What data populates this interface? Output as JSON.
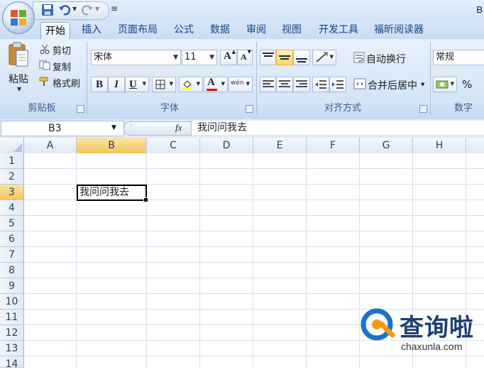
{
  "title_partial": "B",
  "tabs": [
    "开始",
    "插入",
    "页面布局",
    "公式",
    "数据",
    "审阅",
    "视图",
    "开发工具",
    "福昕阅读器"
  ],
  "clipboard": {
    "paste": "粘贴",
    "cut": "剪切",
    "copy": "复制",
    "format_painter": "格式刷",
    "label": "剪贴板"
  },
  "font": {
    "name": "宋体",
    "size": "11",
    "bold": "B",
    "italic": "I",
    "underline": "U",
    "label": "字体",
    "grow": "A",
    "shrink": "A",
    "phonetic": "wén"
  },
  "alignment": {
    "wrap": "自动换行",
    "merge": "合并后居中",
    "label": "对齐方式"
  },
  "number": {
    "format": "常规",
    "percent": "%",
    "label": "数字"
  },
  "formula_bar": {
    "name_box": "B3",
    "fx": "fx",
    "content": "我问问我去"
  },
  "columns": [
    "A",
    "B",
    "C",
    "D",
    "E",
    "F",
    "G",
    "H"
  ],
  "rows": [
    "1",
    "2",
    "3",
    "4",
    "5",
    "6",
    "7",
    "8",
    "9",
    "10",
    "11",
    "12",
    "13",
    "14"
  ],
  "selected_column": "B",
  "selected_row": "3",
  "cell_B3": "我问问我去",
  "watermark": {
    "brand": "查询啦",
    "url": "chaxunla.com"
  },
  "colors": {
    "accent": "#15428b",
    "ribbon": "#d3e3f6",
    "selection": "#f6c65c",
    "watermark_blue": "#1a73c9",
    "watermark_orange": "#f39c12"
  }
}
